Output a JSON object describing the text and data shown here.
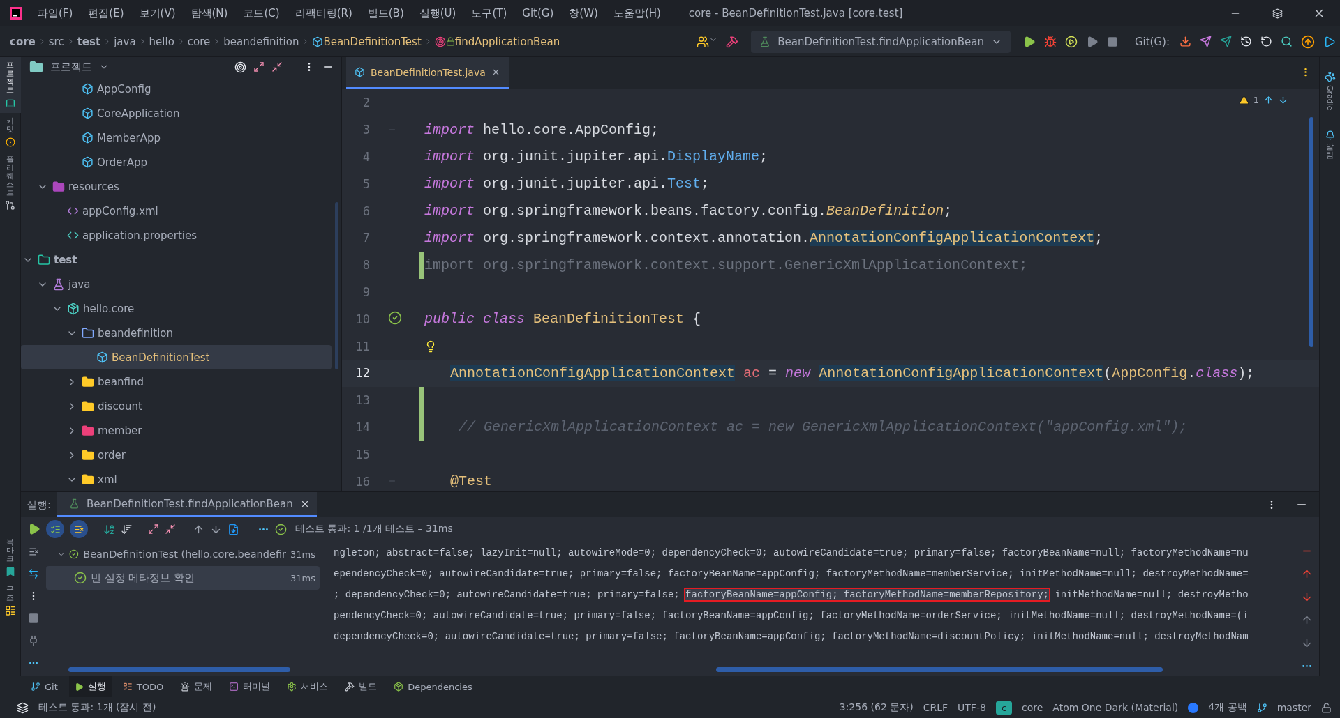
{
  "window": {
    "title": "core - BeanDefinitionTest.java [core.test]"
  },
  "menu": [
    "파일(F)",
    "편집(E)",
    "보기(V)",
    "탐색(N)",
    "코드(C)",
    "리팩터링(R)",
    "빌드(B)",
    "실행(U)",
    "도구(T)",
    "Git(G)",
    "창(W)",
    "도움말(H)"
  ],
  "breadcrumbs": [
    {
      "label": "core",
      "kind": "module"
    },
    {
      "label": "src",
      "kind": "folder"
    },
    {
      "label": "test",
      "kind": "module"
    },
    {
      "label": "java",
      "kind": "folder"
    },
    {
      "label": "hello",
      "kind": "folder"
    },
    {
      "label": "core",
      "kind": "folder"
    },
    {
      "label": "beandefinition",
      "kind": "folder"
    },
    {
      "label": "BeanDefinitionTest",
      "kind": "class"
    },
    {
      "label": "findApplicationBean",
      "kind": "method"
    }
  ],
  "run_config": {
    "label": "BeanDefinitionTest.findApplicationBean"
  },
  "git_label": "Git(G):",
  "left_stripe": [
    {
      "label": "프로젝트",
      "selected": true,
      "kind": "project"
    },
    {
      "label": "커밋",
      "selected": false,
      "kind": "commit"
    },
    {
      "label": "풀 리퀘스트",
      "selected": false,
      "kind": "pull"
    }
  ],
  "left_stripe_bottom": [
    {
      "label": "북마크",
      "kind": "bookmark"
    },
    {
      "label": "구조",
      "kind": "structure"
    }
  ],
  "right_stripe": [
    {
      "label": "Gradle",
      "kind": "gradle"
    },
    {
      "label": "알림",
      "kind": "bell"
    }
  ],
  "project_panel": {
    "title": "프로젝트"
  },
  "tree": [
    {
      "children": [
        {
          "children": [
            {
              "children": [
                {
                  "label": "AppConfig",
                  "kind": "class",
                  "selected": false
                },
                {
                  "label": "CoreApplication",
                  "kind": "class-run",
                  "selected": false
                },
                {
                  "label": "MemberApp",
                  "kind": "class-run",
                  "selected": false
                },
                {
                  "label": "OrderApp",
                  "kind": "class-run",
                  "selected": false
                }
              ]
            }
          ]
        },
        {
          "label": "resources",
          "kind": "resources",
          "expanded": true,
          "selected": false,
          "children": [
            {
              "label": "appConfig.xml",
              "kind": "xml",
              "selected": false
            },
            {
              "label": "application.properties",
              "kind": "properties",
              "selected": false
            }
          ]
        }
      ]
    },
    {
      "label": "test",
      "kind": "test-root",
      "expanded": true,
      "selected": false,
      "children": [
        {
          "label": "java",
          "kind": "test-java",
          "expanded": true,
          "selected": false,
          "children": [
            {
              "label": "hello.core",
              "kind": "package",
              "expanded": true,
              "selected": false,
              "children": [
                {
                  "label": "beandefinition",
                  "kind": "folder",
                  "expanded": true,
                  "selected": false,
                  "children": [
                    {
                      "label": "BeanDefinitionTest",
                      "kind": "class-run",
                      "selected": true
                    }
                  ]
                },
                {
                  "label": "beanfind",
                  "kind": "folder-closed",
                  "expanded": false,
                  "selected": false
                },
                {
                  "label": "discount",
                  "kind": "folder-closed",
                  "expanded": false,
                  "selected": false
                },
                {
                  "label": "member",
                  "kind": "folder-pink",
                  "expanded": false,
                  "selected": false
                },
                {
                  "label": "order",
                  "kind": "folder-closed",
                  "expanded": false,
                  "selected": false
                },
                {
                  "label": "xml",
                  "kind": "folder-closed",
                  "expanded": true,
                  "selected": false
                }
              ]
            }
          ]
        }
      ]
    }
  ],
  "editor": {
    "tabs": [
      {
        "label": "BeanDefinitionTest.java",
        "selected": true
      }
    ],
    "warnings": "1",
    "lines": [
      {
        "number": "2",
        "kind": "plain"
      },
      {
        "number": "3",
        "kind": "fold",
        "tokens": [
          {
            "text": "import",
            "kind": "keyword"
          },
          {
            "text": " hello.core.AppConfig;",
            "kind": "plain"
          }
        ]
      },
      {
        "number": "4",
        "kind": "plain",
        "tokens": [
          {
            "text": "import",
            "kind": "keyword"
          },
          {
            "text": " org.junit.jupiter.api.",
            "kind": "plain"
          },
          {
            "text": "DisplayName",
            "kind": "type"
          },
          {
            "text": ";",
            "kind": "plain"
          }
        ]
      },
      {
        "number": "5",
        "kind": "plain",
        "tokens": [
          {
            "text": "import",
            "kind": "keyword"
          },
          {
            "text": " org.junit.jupiter.api.",
            "kind": "plain"
          },
          {
            "text": "Test",
            "kind": "type"
          },
          {
            "text": ";",
            "kind": "plain"
          }
        ]
      },
      {
        "number": "6",
        "kind": "plain",
        "tokens": [
          {
            "text": "import",
            "kind": "keyword"
          },
          {
            "text": " org.springframework.beans.factory.config.",
            "kind": "plain"
          },
          {
            "text": "BeanDefinition",
            "kind": "interface"
          },
          {
            "text": ";",
            "kind": "plain"
          }
        ]
      },
      {
        "number": "7",
        "kind": "plain",
        "tokens": [
          {
            "text": "import",
            "kind": "keyword"
          },
          {
            "text": " org.springframework.context.annotation.",
            "kind": "plain"
          },
          {
            "text": "AnnotationConfigApplicationContext",
            "kind": "class",
            "highlight": true
          },
          {
            "text": ";",
            "kind": "plain"
          }
        ]
      },
      {
        "number": "8",
        "kind": "plain",
        "changed": true,
        "tokens": [
          {
            "text": "import org.springframework.context.support.GenericXmlApplicationContext;",
            "kind": "unused"
          }
        ]
      },
      {
        "number": "9",
        "kind": "plain"
      },
      {
        "number": "10",
        "kind": "run-passed",
        "tokens": [
          {
            "text": "public",
            "kind": "keyword"
          },
          {
            "text": " class",
            "kind": "keyword"
          },
          {
            "text": " BeanDefinitionTest",
            "kind": "class"
          },
          {
            "text": " {",
            "kind": "plain"
          }
        ]
      },
      {
        "number": "11",
        "kind": "bulb"
      },
      {
        "number": "12",
        "kind": "plain",
        "current": true,
        "indented": true,
        "tokens": [
          {
            "text": "AnnotationConfigApplicationContext",
            "kind": "class",
            "highlight": true
          },
          {
            "text": " ac",
            "kind": "variable"
          },
          {
            "text": " = ",
            "kind": "plain"
          },
          {
            "text": "new ",
            "kind": "keyword"
          },
          {
            "text": "AnnotationConfigApplicationContext",
            "kind": "class",
            "highlight": true
          },
          {
            "text": "(",
            "kind": "plain"
          },
          {
            "text": "AppConfig",
            "kind": "class"
          },
          {
            "text": ".",
            "kind": "plain"
          },
          {
            "text": "class",
            "kind": "keyword"
          },
          {
            "text": ");",
            "kind": "plain"
          }
        ]
      },
      {
        "number": "13",
        "kind": "plain",
        "changed": true
      },
      {
        "number": "14",
        "kind": "plain",
        "changed": true,
        "indented": true,
        "tokens": [
          {
            "text": " // GenericXmlApplicationContext ac = new GenericXmlApplicationContext(\"appConfig.xml\");",
            "kind": "comment"
          }
        ]
      },
      {
        "number": "15",
        "kind": "plain"
      },
      {
        "number": "16",
        "kind": "fold",
        "indented": true,
        "tokens": [
          {
            "text": "@Test",
            "kind": "annotation"
          }
        ]
      }
    ]
  },
  "run_panel": {
    "label": "실행:",
    "tab": "BeanDefinitionTest.findApplicationBean",
    "summary": "테스트 통과: 1 /1개 테스트 – 31ms",
    "tests": [
      {
        "label": "BeanDefinitionTest (hello.core.beandefir",
        "time": "31ms",
        "expanded": true,
        "selected": false,
        "children": [
          {
            "label": "빈 설정 메타정보 확인",
            "time": "31ms",
            "selected": true
          }
        ]
      }
    ],
    "console": [
      [
        {
          "text": "ngleton; abstract=false; lazyInit=null; autowireMode=0; dependencyCheck=0; autowireCandidate=true; primary=false; factoryBeanName=null; factoryMethodName=nu",
          "kind": "plain"
        }
      ],
      [
        {
          "text": "ependencyCheck=0; autowireCandidate=true; primary=false; factoryBeanName=appConfig; factoryMethodName=memberService; initMethodName=null; destroyMethodName=",
          "kind": "plain"
        }
      ],
      [
        {
          "text": "; dependencyCheck=0; autowireCandidate=true; primary=false; ",
          "kind": "plain"
        },
        {
          "text": "factoryBeanName=appConfig; factoryMethodName=memberRepository;",
          "kind": "boxed"
        },
        {
          "text": " initMethodName=null; destroyMetho",
          "kind": "plain"
        }
      ],
      [
        {
          "text": "pendencyCheck=0; autowireCandidate=true; primary=false; factoryBeanName=appConfig; factoryMethodName=orderService; initMethodName=null; destroyMethodName=(i",
          "kind": "plain"
        }
      ],
      [
        {
          "text": "dependencyCheck=0; autowireCandidate=true; primary=false; factoryBeanName=appConfig; factoryMethodName=discountPolicy; initMethodName=null; destroyMethodNam",
          "kind": "plain"
        }
      ]
    ]
  },
  "tool_tabs": [
    {
      "label": "Git",
      "kind": "git",
      "selected": false
    },
    {
      "label": "실행",
      "kind": "run",
      "selected": true
    },
    {
      "label": "TODO",
      "kind": "todo",
      "selected": false
    },
    {
      "label": "문제",
      "kind": "problems",
      "selected": false
    },
    {
      "label": "터미널",
      "kind": "terminal",
      "selected": false
    },
    {
      "label": "서비스",
      "kind": "services",
      "selected": false
    },
    {
      "label": "빌드",
      "kind": "build",
      "selected": false
    },
    {
      "label": "Dependencies",
      "kind": "deps",
      "selected": false
    }
  ],
  "status_bar": {
    "message": "테스트 통과: 1개 (잠시 전)",
    "position": "3:256 (62 문자)",
    "line_ending": "CRLF",
    "encoding": "UTF-8",
    "module_badge": "c",
    "module": "core",
    "theme": "Atom One Dark (Material)",
    "indent": "4개 공백",
    "branch": "master"
  }
}
